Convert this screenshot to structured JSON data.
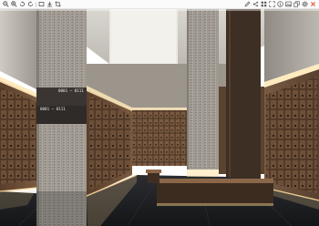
{
  "toolbar": {
    "left_icons": [
      "zoom-out-icon",
      "zoom-in-icon",
      "rotate-left-icon",
      "rotate-right-icon",
      "fit-screen-icon",
      "download-icon",
      "crop-icon"
    ],
    "right_icons": [
      "edit-icon",
      "share-icon",
      "grid-icon",
      "fullscreen-icon",
      "info-icon",
      "gallery-icon",
      "copy-icon",
      "settings-icon",
      "close-icon"
    ],
    "close_color": "#e05a2b"
  },
  "scene": {
    "description_color_wood": "#6b4e36",
    "description_color_floor": "#1b1d20",
    "column_label_1": "0001 — 0111",
    "column_label_2": "0001 — 0111"
  }
}
